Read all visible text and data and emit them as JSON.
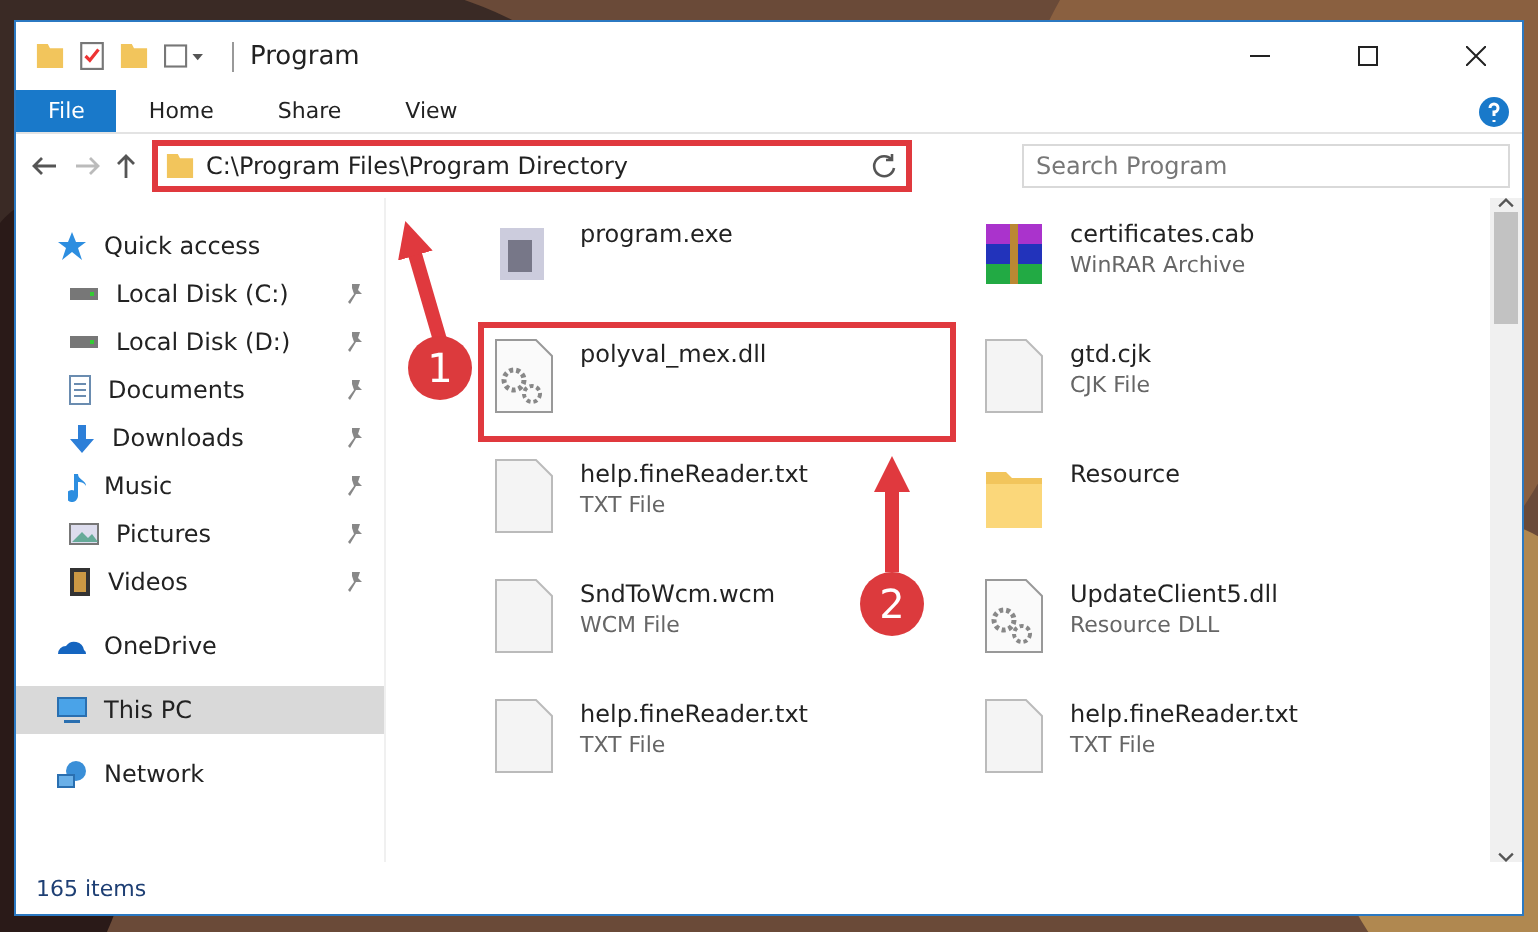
{
  "window": {
    "title": "Program"
  },
  "ribbon": {
    "tabs": [
      {
        "label": "File",
        "kind": "file"
      },
      {
        "label": "Home",
        "kind": "tab"
      },
      {
        "label": "Share",
        "kind": "tab"
      },
      {
        "label": "View",
        "kind": "tab"
      }
    ]
  },
  "address": {
    "path": "C:\\Program Files\\Program Directory",
    "highlighted": true
  },
  "search": {
    "placeholder": "Search Program"
  },
  "sidebar": {
    "items": [
      {
        "label": "Quick access",
        "kind": "star",
        "selected": false,
        "children": [
          {
            "label": "Local Disk (C:)",
            "kind": "disk",
            "pinned": true,
            "selected": false
          },
          {
            "label": "Local Disk (D:)",
            "kind": "disk",
            "pinned": true,
            "selected": false
          },
          {
            "label": "Documents",
            "kind": "doc",
            "pinned": true,
            "selected": false
          },
          {
            "label": "Downloads",
            "kind": "download",
            "pinned": true,
            "selected": false
          },
          {
            "label": "Music",
            "kind": "music",
            "pinned": true,
            "selected": false
          },
          {
            "label": "Pictures",
            "kind": "pictures",
            "pinned": true,
            "selected": false
          },
          {
            "label": "Videos",
            "kind": "videos",
            "pinned": true,
            "selected": false
          }
        ]
      },
      {
        "label": "OneDrive",
        "kind": "cloud",
        "selected": false
      },
      {
        "label": "This PC",
        "kind": "pc",
        "selected": true
      },
      {
        "label": "Network",
        "kind": "network",
        "selected": false
      }
    ]
  },
  "files": [
    {
      "name": "program.exe",
      "kind": "exe",
      "highlighted": false
    },
    {
      "name": "certificates.cab",
      "type": "WinRAR Archive",
      "kind": "archive",
      "highlighted": false
    },
    {
      "name": "polyval_mex.dll",
      "kind": "dll",
      "highlighted": true
    },
    {
      "name": "gtd.cjk",
      "type": "CJK File",
      "kind": "blank",
      "highlighted": false
    },
    {
      "name": "help.fineReader.txt",
      "type": "TXT File",
      "kind": "blank",
      "highlighted": false
    },
    {
      "name": "Resource",
      "kind": "folder",
      "highlighted": false
    },
    {
      "name": "SndToWcm.wcm",
      "type": "WCM File",
      "kind": "blank",
      "highlighted": false
    },
    {
      "name": "UpdateClient5.dll",
      "type": "Resource DLL",
      "kind": "dll",
      "highlighted": false
    },
    {
      "name": "help.fineReader.txt",
      "type": "TXT File",
      "kind": "blank",
      "highlighted": false
    },
    {
      "name": "help.fineReader.txt",
      "type": "TXT File",
      "kind": "blank",
      "highlighted": false
    }
  ],
  "annotations": [
    {
      "number": "1"
    },
    {
      "number": "2"
    }
  ],
  "status_bar": {
    "count": "165 items"
  }
}
